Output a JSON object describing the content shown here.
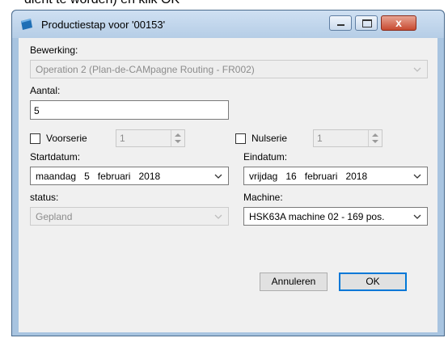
{
  "doc_caption": "dient te worden) en klik OK",
  "window": {
    "title": "Productiestap voor '00153'",
    "close_glyph": "x"
  },
  "form": {
    "bewerking_label": "Bewerking:",
    "bewerking_value": "Operation 2 (Plan-de-CAMpagne Routing - FR002)",
    "aantal_label": "Aantal:",
    "aantal_value": "5",
    "voorserie_label": "Voorserie",
    "voorserie_value": "1",
    "nulserie_label": "Nulserie",
    "nulserie_value": "1",
    "startdatum_label": "Startdatum:",
    "startdatum": {
      "day": "maandag",
      "date": "5",
      "month": "februari",
      "year": "2018"
    },
    "eindatum_label": "Eindatum:",
    "eindatum": {
      "day": "vrijdag",
      "date": "16",
      "month": "februari",
      "year": "2018"
    },
    "status_label": "status:",
    "status_value": "Gepland",
    "machine_label": "Machine:",
    "machine_value": "HSK63A machine 02 - 169 pos."
  },
  "buttons": {
    "cancel": "Annuleren",
    "ok": "OK"
  },
  "colors": {
    "title_bg": "#b5cde6",
    "client_bg": "#f0f0f0",
    "default_button_border": "#0078d7",
    "close_button": "#c74a30"
  }
}
